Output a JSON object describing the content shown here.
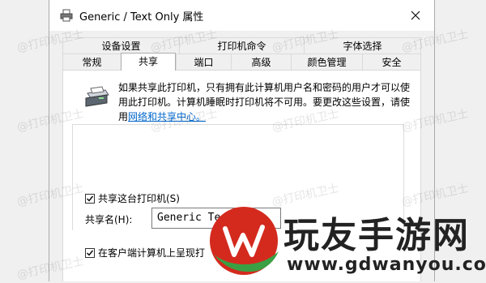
{
  "window": {
    "title": "Generic / Text Only 属性",
    "close_icon": "close-icon"
  },
  "tabs": {
    "row1": [
      "设备设置",
      "打印机命令",
      "字体选择"
    ],
    "row2": [
      "常规",
      "共享",
      "端口",
      "高级",
      "颜色管理",
      "安全"
    ],
    "active": "共享"
  },
  "share": {
    "info_text": "如果共享此打印机，只有拥有此计算机用户名和密码的用户才可以使用此打印机。计算机睡眠时打印机将不可用。要更改这些设置，请使用",
    "info_link": "网络和共享中心。",
    "share_checkbox_label": "共享这台打印机(S)",
    "share_checkbox_checked": true,
    "share_name_label": "共享名(H):",
    "share_name_value": "Generic  Te",
    "render_checkbox_label": "在客户端计算机上呈现打",
    "render_checkbox_checked": true
  },
  "watermark": {
    "text": "@打印机卫士"
  },
  "brand": {
    "name": "玩友手游网",
    "url": "www.gdwanyou.com",
    "accent_red": "#d42a1e",
    "accent_green": "#3aa043"
  }
}
